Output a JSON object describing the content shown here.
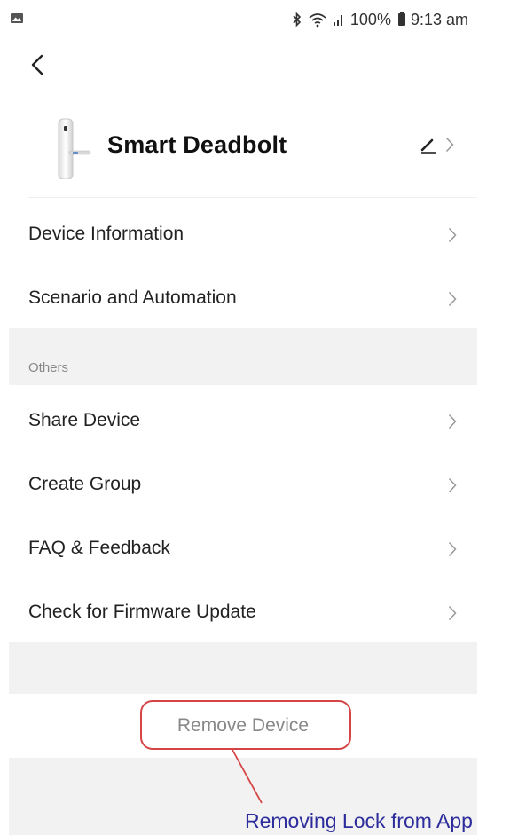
{
  "status_bar": {
    "battery": "100%",
    "time": "9:13 am"
  },
  "device": {
    "name": "Smart Deadbolt"
  },
  "menu": {
    "items": [
      {
        "label": "Device Information"
      },
      {
        "label": "Scenario and Automation"
      }
    ]
  },
  "others": {
    "section_label": "Others",
    "items": [
      {
        "label": "Share Device"
      },
      {
        "label": "Create Group"
      },
      {
        "label": "FAQ & Feedback"
      },
      {
        "label": "Check for Firmware Update"
      }
    ]
  },
  "remove_device": {
    "label": "Remove Device"
  },
  "annotation": {
    "text": "Removing Lock from App",
    "highlight_color": "#d64545",
    "text_color": "#2c2c9c"
  },
  "icons": [
    "gallery-icon",
    "bluetooth-icon",
    "wifi-icon",
    "signal-icon",
    "battery-icon",
    "back-arrow-icon",
    "lock-device-icon",
    "edit-icon",
    "chevron-right-icon"
  ]
}
